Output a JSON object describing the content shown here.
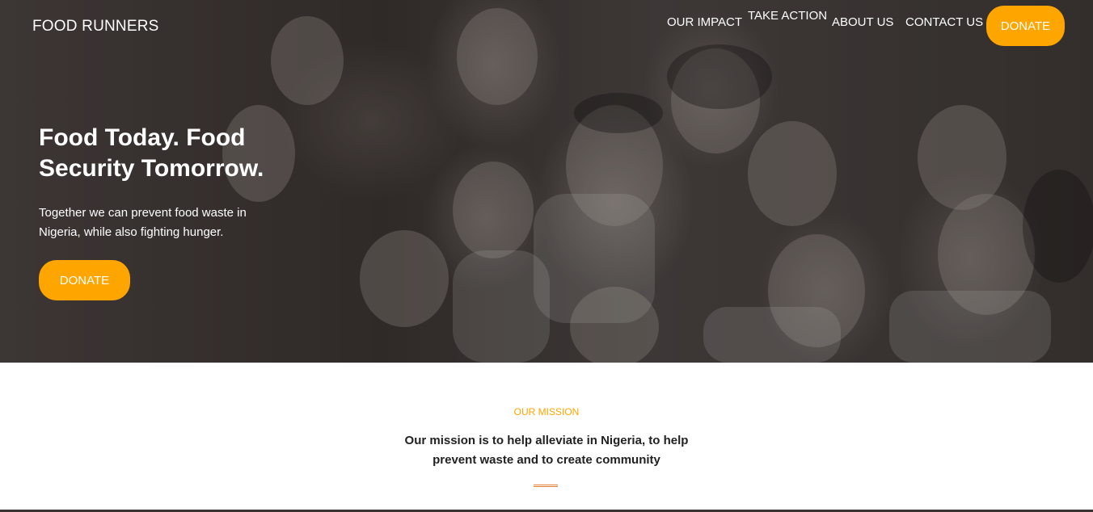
{
  "header": {
    "brand": "FOOD RUNNERS",
    "nav": {
      "our_impact": "OUR IMPACT",
      "take_action": "TAKE ACTION",
      "about_us": "ABOUT US",
      "contact_us": "CONTACT US"
    },
    "donate_label": "DONATE"
  },
  "hero": {
    "title": "Food Today. Food Security Tomorrow.",
    "subtitle": "Together we can prevent food waste in Nigeria, while also fighting hunger.",
    "donate_label": "DONATE"
  },
  "mission": {
    "label": "OUR MISSION",
    "text": "Our mission is to help alleviate in Nigeria, to help prevent waste and to create community"
  },
  "colors": {
    "accent": "#ffa500",
    "hero_overlay": "#3a3331",
    "text_dark": "#222222"
  }
}
